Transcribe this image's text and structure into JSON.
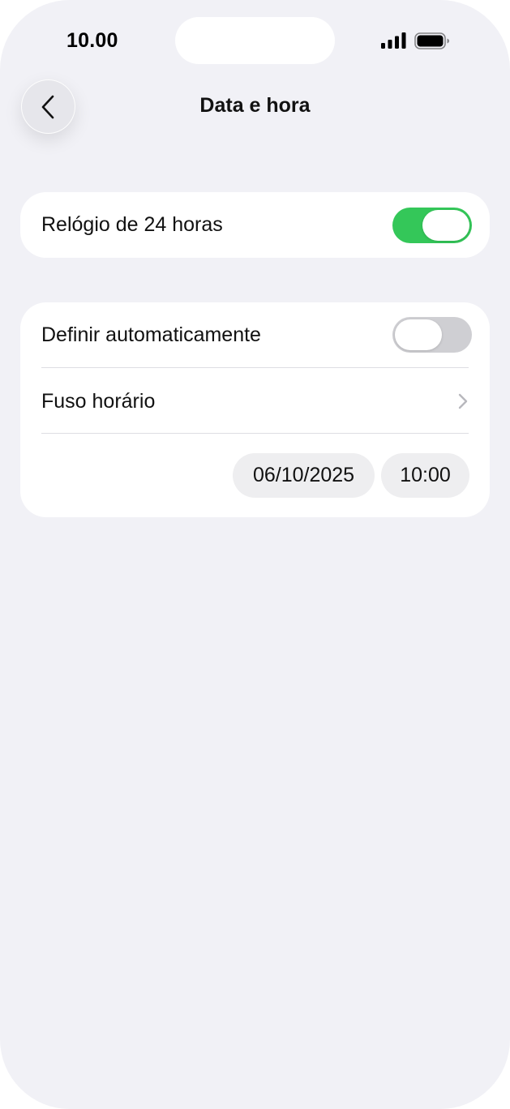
{
  "status_bar": {
    "time": "10.00"
  },
  "header": {
    "title": "Data e hora",
    "back_icon": "chevron-left-icon"
  },
  "settings": {
    "clock_24h": {
      "label": "Relógio de 24 horas",
      "enabled": true
    },
    "auto_set": {
      "label": "Definir automaticamente",
      "enabled": false
    },
    "timezone": {
      "label": "Fuso horário",
      "icon": "chevron-right-icon"
    },
    "date_value": "06/10/2025",
    "time_value": "10:00"
  },
  "colors": {
    "background": "#f1f1f6",
    "card": "#ffffff",
    "toggle_on": "#34c759",
    "toggle_off": "#cfcfd3"
  }
}
